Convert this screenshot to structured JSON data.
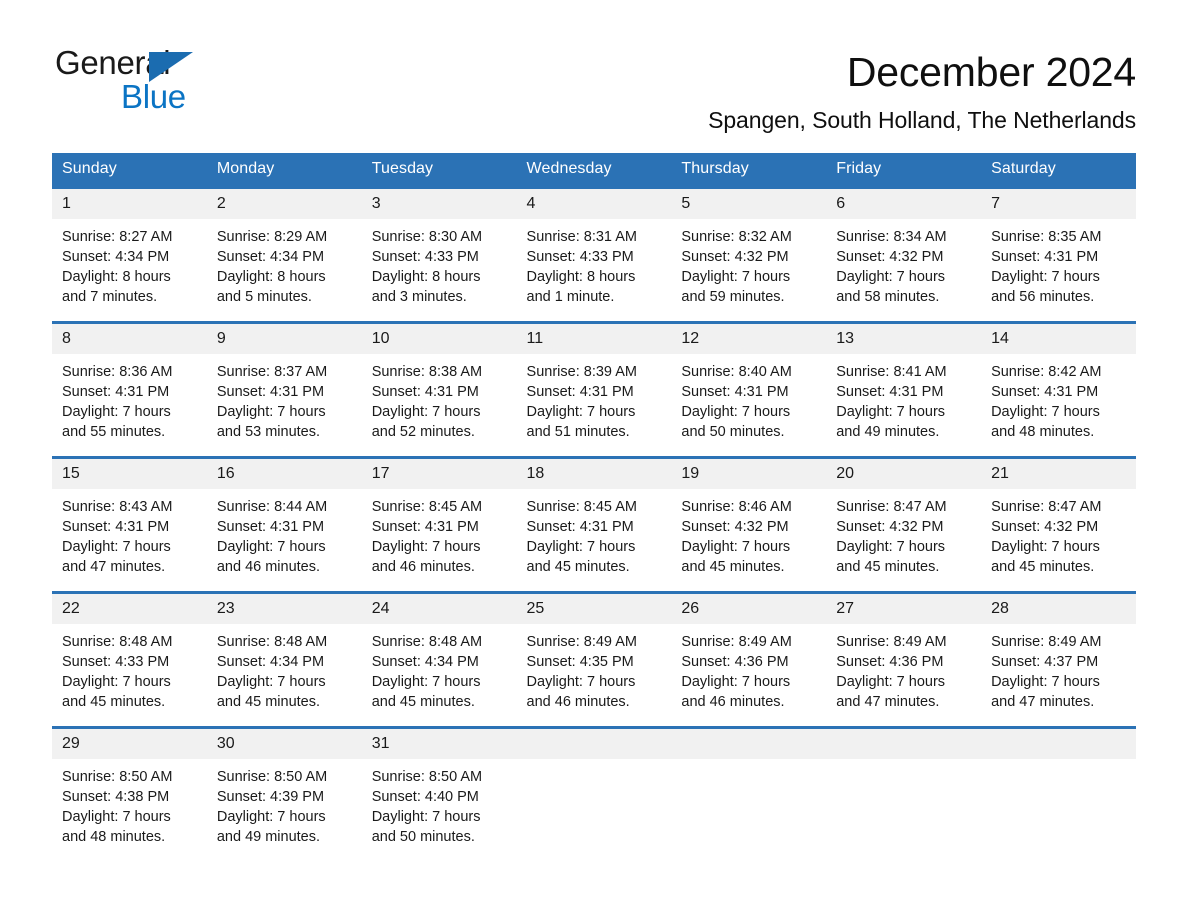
{
  "brand": {
    "name_top": "General",
    "name_bottom": "Blue",
    "accent_color": "#1b6cb0",
    "blue_text_color": "#0b74c4"
  },
  "header": {
    "title": "December 2024",
    "subtitle": "Spangen, South Holland, The Netherlands"
  },
  "theme": {
    "header_band": "#2b72b5",
    "daynum_band": "#f1f1f1",
    "text": "#1a1a1a"
  },
  "weekdays": [
    "Sunday",
    "Monday",
    "Tuesday",
    "Wednesday",
    "Thursday",
    "Friday",
    "Saturday"
  ],
  "weeks": [
    [
      {
        "day": "1",
        "sunrise": "Sunrise: 8:27 AM",
        "sunset": "Sunset: 4:34 PM",
        "daylight1": "Daylight: 8 hours",
        "daylight2": "and 7 minutes."
      },
      {
        "day": "2",
        "sunrise": "Sunrise: 8:29 AM",
        "sunset": "Sunset: 4:34 PM",
        "daylight1": "Daylight: 8 hours",
        "daylight2": "and 5 minutes."
      },
      {
        "day": "3",
        "sunrise": "Sunrise: 8:30 AM",
        "sunset": "Sunset: 4:33 PM",
        "daylight1": "Daylight: 8 hours",
        "daylight2": "and 3 minutes."
      },
      {
        "day": "4",
        "sunrise": "Sunrise: 8:31 AM",
        "sunset": "Sunset: 4:33 PM",
        "daylight1": "Daylight: 8 hours",
        "daylight2": "and 1 minute."
      },
      {
        "day": "5",
        "sunrise": "Sunrise: 8:32 AM",
        "sunset": "Sunset: 4:32 PM",
        "daylight1": "Daylight: 7 hours",
        "daylight2": "and 59 minutes."
      },
      {
        "day": "6",
        "sunrise": "Sunrise: 8:34 AM",
        "sunset": "Sunset: 4:32 PM",
        "daylight1": "Daylight: 7 hours",
        "daylight2": "and 58 minutes."
      },
      {
        "day": "7",
        "sunrise": "Sunrise: 8:35 AM",
        "sunset": "Sunset: 4:31 PM",
        "daylight1": "Daylight: 7 hours",
        "daylight2": "and 56 minutes."
      }
    ],
    [
      {
        "day": "8",
        "sunrise": "Sunrise: 8:36 AM",
        "sunset": "Sunset: 4:31 PM",
        "daylight1": "Daylight: 7 hours",
        "daylight2": "and 55 minutes."
      },
      {
        "day": "9",
        "sunrise": "Sunrise: 8:37 AM",
        "sunset": "Sunset: 4:31 PM",
        "daylight1": "Daylight: 7 hours",
        "daylight2": "and 53 minutes."
      },
      {
        "day": "10",
        "sunrise": "Sunrise: 8:38 AM",
        "sunset": "Sunset: 4:31 PM",
        "daylight1": "Daylight: 7 hours",
        "daylight2": "and 52 minutes."
      },
      {
        "day": "11",
        "sunrise": "Sunrise: 8:39 AM",
        "sunset": "Sunset: 4:31 PM",
        "daylight1": "Daylight: 7 hours",
        "daylight2": "and 51 minutes."
      },
      {
        "day": "12",
        "sunrise": "Sunrise: 8:40 AM",
        "sunset": "Sunset: 4:31 PM",
        "daylight1": "Daylight: 7 hours",
        "daylight2": "and 50 minutes."
      },
      {
        "day": "13",
        "sunrise": "Sunrise: 8:41 AM",
        "sunset": "Sunset: 4:31 PM",
        "daylight1": "Daylight: 7 hours",
        "daylight2": "and 49 minutes."
      },
      {
        "day": "14",
        "sunrise": "Sunrise: 8:42 AM",
        "sunset": "Sunset: 4:31 PM",
        "daylight1": "Daylight: 7 hours",
        "daylight2": "and 48 minutes."
      }
    ],
    [
      {
        "day": "15",
        "sunrise": "Sunrise: 8:43 AM",
        "sunset": "Sunset: 4:31 PM",
        "daylight1": "Daylight: 7 hours",
        "daylight2": "and 47 minutes."
      },
      {
        "day": "16",
        "sunrise": "Sunrise: 8:44 AM",
        "sunset": "Sunset: 4:31 PM",
        "daylight1": "Daylight: 7 hours",
        "daylight2": "and 46 minutes."
      },
      {
        "day": "17",
        "sunrise": "Sunrise: 8:45 AM",
        "sunset": "Sunset: 4:31 PM",
        "daylight1": "Daylight: 7 hours",
        "daylight2": "and 46 minutes."
      },
      {
        "day": "18",
        "sunrise": "Sunrise: 8:45 AM",
        "sunset": "Sunset: 4:31 PM",
        "daylight1": "Daylight: 7 hours",
        "daylight2": "and 45 minutes."
      },
      {
        "day": "19",
        "sunrise": "Sunrise: 8:46 AM",
        "sunset": "Sunset: 4:32 PM",
        "daylight1": "Daylight: 7 hours",
        "daylight2": "and 45 minutes."
      },
      {
        "day": "20",
        "sunrise": "Sunrise: 8:47 AM",
        "sunset": "Sunset: 4:32 PM",
        "daylight1": "Daylight: 7 hours",
        "daylight2": "and 45 minutes."
      },
      {
        "day": "21",
        "sunrise": "Sunrise: 8:47 AM",
        "sunset": "Sunset: 4:32 PM",
        "daylight1": "Daylight: 7 hours",
        "daylight2": "and 45 minutes."
      }
    ],
    [
      {
        "day": "22",
        "sunrise": "Sunrise: 8:48 AM",
        "sunset": "Sunset: 4:33 PM",
        "daylight1": "Daylight: 7 hours",
        "daylight2": "and 45 minutes."
      },
      {
        "day": "23",
        "sunrise": "Sunrise: 8:48 AM",
        "sunset": "Sunset: 4:34 PM",
        "daylight1": "Daylight: 7 hours",
        "daylight2": "and 45 minutes."
      },
      {
        "day": "24",
        "sunrise": "Sunrise: 8:48 AM",
        "sunset": "Sunset: 4:34 PM",
        "daylight1": "Daylight: 7 hours",
        "daylight2": "and 45 minutes."
      },
      {
        "day": "25",
        "sunrise": "Sunrise: 8:49 AM",
        "sunset": "Sunset: 4:35 PM",
        "daylight1": "Daylight: 7 hours",
        "daylight2": "and 46 minutes."
      },
      {
        "day": "26",
        "sunrise": "Sunrise: 8:49 AM",
        "sunset": "Sunset: 4:36 PM",
        "daylight1": "Daylight: 7 hours",
        "daylight2": "and 46 minutes."
      },
      {
        "day": "27",
        "sunrise": "Sunrise: 8:49 AM",
        "sunset": "Sunset: 4:36 PM",
        "daylight1": "Daylight: 7 hours",
        "daylight2": "and 47 minutes."
      },
      {
        "day": "28",
        "sunrise": "Sunrise: 8:49 AM",
        "sunset": "Sunset: 4:37 PM",
        "daylight1": "Daylight: 7 hours",
        "daylight2": "and 47 minutes."
      }
    ],
    [
      {
        "day": "29",
        "sunrise": "Sunrise: 8:50 AM",
        "sunset": "Sunset: 4:38 PM",
        "daylight1": "Daylight: 7 hours",
        "daylight2": "and 48 minutes."
      },
      {
        "day": "30",
        "sunrise": "Sunrise: 8:50 AM",
        "sunset": "Sunset: 4:39 PM",
        "daylight1": "Daylight: 7 hours",
        "daylight2": "and 49 minutes."
      },
      {
        "day": "31",
        "sunrise": "Sunrise: 8:50 AM",
        "sunset": "Sunset: 4:40 PM",
        "daylight1": "Daylight: 7 hours",
        "daylight2": "and 50 minutes."
      },
      {
        "day": "",
        "sunrise": "",
        "sunset": "",
        "daylight1": "",
        "daylight2": ""
      },
      {
        "day": "",
        "sunrise": "",
        "sunset": "",
        "daylight1": "",
        "daylight2": ""
      },
      {
        "day": "",
        "sunrise": "",
        "sunset": "",
        "daylight1": "",
        "daylight2": ""
      },
      {
        "day": "",
        "sunrise": "",
        "sunset": "",
        "daylight1": "",
        "daylight2": ""
      }
    ]
  ]
}
